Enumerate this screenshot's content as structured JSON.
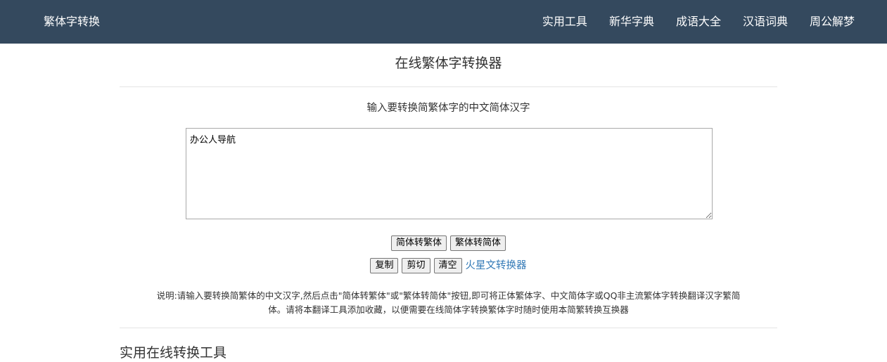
{
  "navbar": {
    "brand": "繁体字转换",
    "links": [
      "实用工具",
      "新华字典",
      "成语大全",
      "汉语词典",
      "周公解梦"
    ]
  },
  "main": {
    "title": "在线繁体字转换器",
    "instruction": "输入要转换简繁体字的中文简体汉字",
    "input_value": "办公人导航",
    "buttons": {
      "to_traditional": "简体转繁体",
      "to_simplified": "繁体转简体",
      "copy": "复制",
      "cut": "剪切",
      "clear": "清空"
    },
    "mars_link": "火星文转换器",
    "description_line1": "说明:请输入要转换简繁体的中文汉字,然后点击\"简体转繁体\"或\"繁体转简体\"按钮,即可将正体繁体字、中文简体字或QQ非主流繁体字转换翻译汉字繁简",
    "description_line2": "体。请将本翻译工具添加收藏，以便需要在线简体字转换繁体字时随时使用本简繁转换互换器",
    "section_title": "实用在线转换工具"
  },
  "colors": {
    "navbar_bg": "#34495e",
    "link": "#337ab7"
  }
}
